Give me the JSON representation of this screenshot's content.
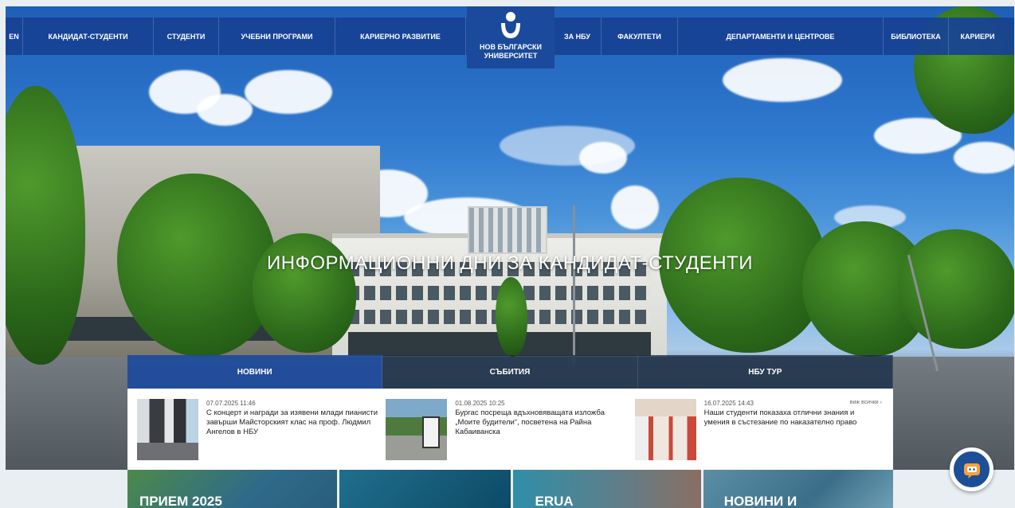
{
  "nav": {
    "lang": "EN",
    "items": [
      "Кандидат-студенти",
      "Студенти",
      "Учебни програми",
      "Кариерно развитие",
      "За НБУ",
      "Факултети",
      "Департаменти и центрове",
      "Библиотека",
      "Кариери"
    ]
  },
  "logo": {
    "line1": "НОВ БЪЛГАРСКИ",
    "line2": "УНИВЕРСИТЕТ"
  },
  "hero": {
    "title": "ИНФОРМАЦИОННИ ДНИ ЗА КАНДИДАТ-СТУДЕНТИ"
  },
  "tabs": [
    "НОВИНИ",
    "СЪБИТИЯ",
    "НБУ ТУР"
  ],
  "news": {
    "see_all": "виж всички ›",
    "items": [
      {
        "date": "07.07.2025 11:46",
        "title": "С концерт и награди за изявени млади пианисти завърши Майсторският клас на проф. Людмил Ангелов в НБУ"
      },
      {
        "date": "01.08.2025 10:25",
        "title": "Бургас посреща вдъхновяващата изложба „Моите будители“, посветена на Райна Кабаиванска"
      },
      {
        "date": "16.07.2025 14:43",
        "title": "Наши студенти показаха отлични знания и умения в състезание по наказателно право"
      }
    ]
  },
  "cards": [
    "ПРИЕМ 2025",
    "",
    "ERUA",
    "НОВИНИ И"
  ],
  "colors": {
    "nav_bg": "#184294",
    "accent": "#1c4a9c"
  }
}
